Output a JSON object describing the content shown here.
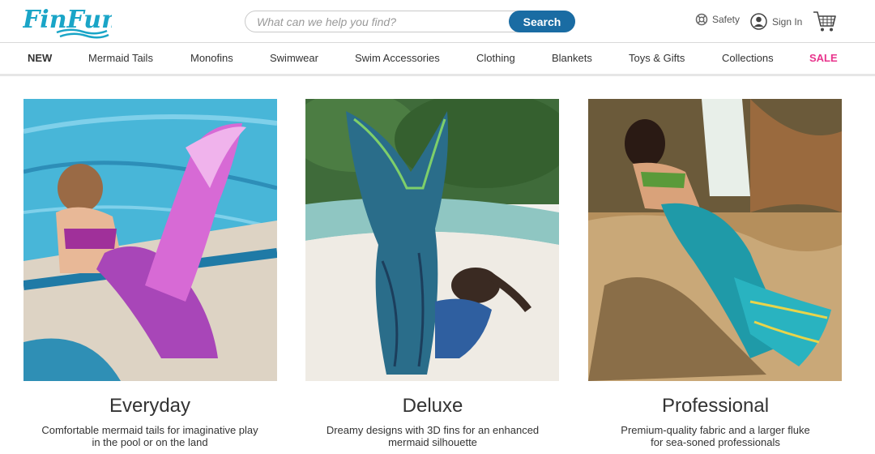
{
  "header": {
    "logo_text": "FinFun",
    "search_placeholder": "What can we help you find?",
    "search_button": "Search",
    "safety_label": "Safety",
    "signin_label": "Sign In"
  },
  "nav": {
    "items": [
      "NEW",
      "Mermaid Tails",
      "Monofins",
      "Swimwear",
      "Swim Accessories",
      "Clothing",
      "Blankets",
      "Toys & Gifts",
      "Collections",
      "SALE"
    ]
  },
  "cards": [
    {
      "title": "Everyday",
      "desc_line1": "Comfortable mermaid tails for imaginative play",
      "desc_line2": "in the pool or on the land"
    },
    {
      "title": "Deluxe",
      "desc_line1": "Dreamy designs with 3D fins for an enhanced",
      "desc_line2": "mermaid silhouette"
    },
    {
      "title": "Professional",
      "desc_line1": "Premium-quality fabric and a larger fluke",
      "desc_line2": "for sea-soned professionals"
    }
  ],
  "colors": {
    "brand_blue": "#1a6ca3",
    "logo_teal": "#1aa5c7",
    "sale_pink": "#e8348c"
  }
}
